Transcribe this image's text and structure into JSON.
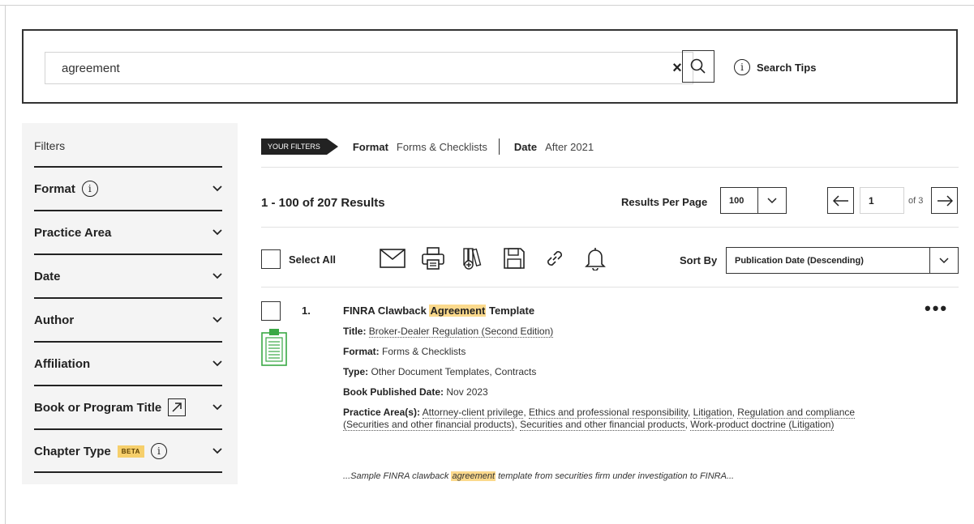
{
  "search": {
    "query": "agreement",
    "clear_label": "×",
    "tips_label": "Search Tips"
  },
  "sidebar": {
    "title": "Filters",
    "items": [
      {
        "label": "Format"
      },
      {
        "label": "Practice Area"
      },
      {
        "label": "Date"
      },
      {
        "label": "Author"
      },
      {
        "label": "Affiliation"
      },
      {
        "label": "Book or Program Title"
      },
      {
        "label": "Chapter Type",
        "badge": "BETA"
      }
    ]
  },
  "filter_bar": {
    "tag": "YOUR FILTERS",
    "filters": [
      {
        "key": "Format",
        "value": "Forms & Checklists"
      },
      {
        "key": "Date",
        "value": "After 2021"
      }
    ]
  },
  "results": {
    "count_text": "1 - 100 of 207 Results",
    "per_page_label": "Results Per Page",
    "per_page_value": "100",
    "page_value": "1",
    "of_pages": "of 3"
  },
  "toolbar": {
    "select_all_label": "Select All",
    "icons": [
      "email-icon",
      "print-icon",
      "add-to-library-icon",
      "save-icon",
      "link-icon",
      "alert-bell-icon"
    ],
    "sort_label": "Sort By",
    "sort_value": "Publication Date (Descending)"
  },
  "result_items": [
    {
      "number": "1.",
      "title_pre": "FINRA Clawback ",
      "title_hl": "Agreement",
      "title_post": " Template",
      "more": "•••",
      "fields": {
        "title_label": "Title:",
        "title_value": "Broker-Dealer Regulation (Second Edition)",
        "format_label": "Format:",
        "format_value": "Forms & Checklists",
        "type_label": "Type:",
        "type_value": "Other Document Templates, Contracts",
        "published_label": "Book Published Date:",
        "published_value": "Nov 2023",
        "practice_label": "Practice Area(s):",
        "practice_1": "Attorney-client privilege",
        "practice_2": "Ethics and professional responsibility",
        "practice_3": "Litigation",
        "practice_4": "Regulation and compliance (Securities and other financial products)",
        "practice_5": "Securities and other financial products",
        "practice_6": "Work-product doctrine (Litigation)"
      },
      "snippet_pre": "...Sample FINRA clawback ",
      "snippet_hl": "agreement",
      "snippet_post": " template from securities firm under investigation to FINRA..."
    }
  ],
  "colors": {
    "highlight": "#fbd98c",
    "beta_badge": "#f6cf6b",
    "doc_icon_green": "#3aa845",
    "sidebar_bg": "#f4f4f4"
  }
}
